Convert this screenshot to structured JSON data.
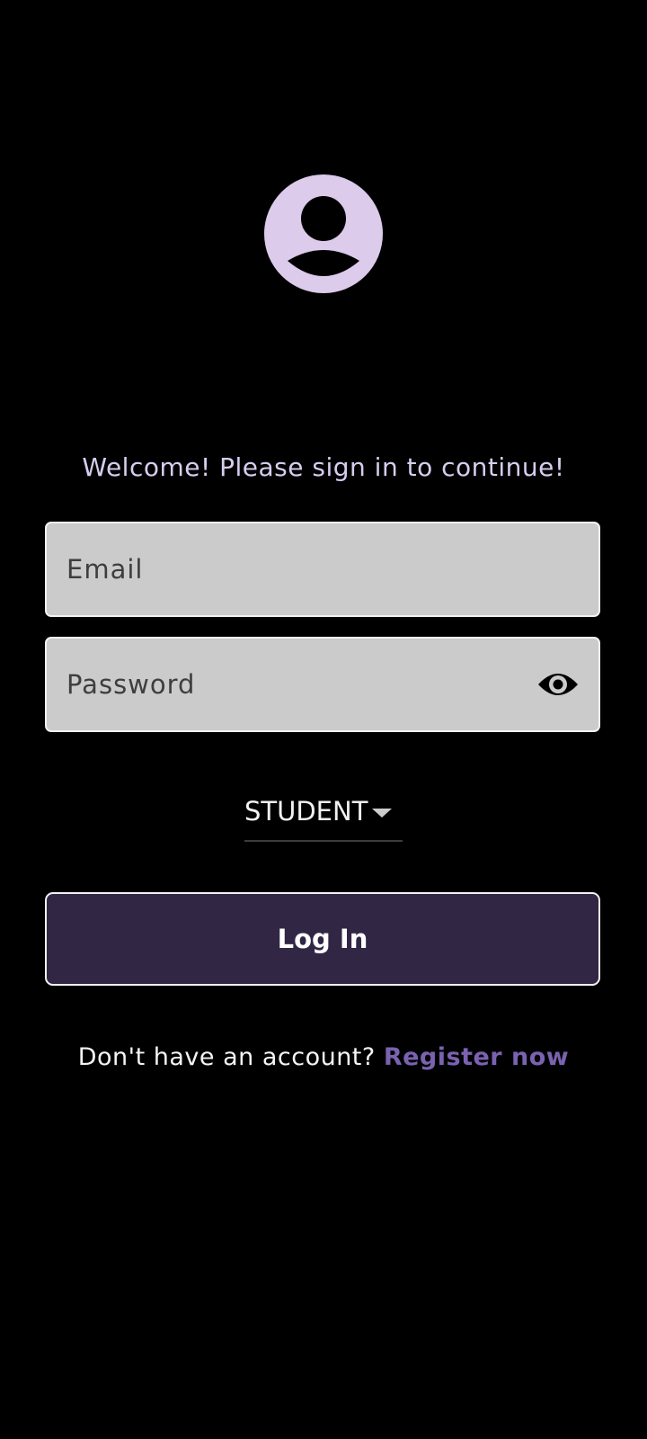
{
  "header": {
    "avatar_icon": "account-circle-icon",
    "avatar_color": "#dccbea"
  },
  "form": {
    "welcome_text": "Welcome! Please sign in to continue!",
    "email": {
      "placeholder": "Email",
      "value": ""
    },
    "password": {
      "placeholder": "Password",
      "value": "",
      "toggle_icon": "eye-icon"
    },
    "role": {
      "selected": "STUDENT",
      "icon": "caret-down-icon"
    },
    "login_label": "Log In"
  },
  "footer": {
    "prompt": "Don't have an account?",
    "register_label": "Register now",
    "link_color": "#7a62b0"
  },
  "colors": {
    "background": "#000000",
    "accent_button": "#312644",
    "field_background": "#cbcbcb",
    "welcome_text": "#d7cdef"
  }
}
